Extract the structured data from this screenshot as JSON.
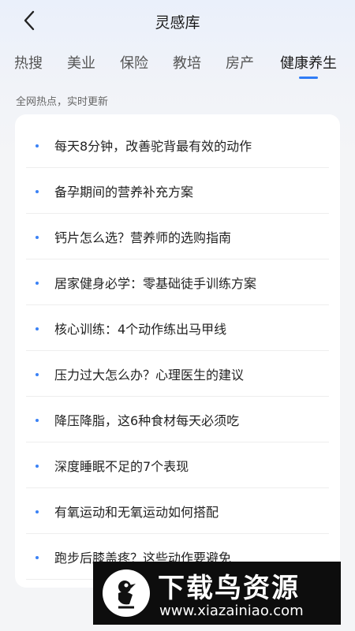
{
  "header": {
    "back_icon": "chevron-left-icon",
    "title": "灵感库"
  },
  "tabs": [
    {
      "label": "热搜",
      "active": false
    },
    {
      "label": "美业",
      "active": false
    },
    {
      "label": "保险",
      "active": false
    },
    {
      "label": "教培",
      "active": false
    },
    {
      "label": "房产",
      "active": false
    },
    {
      "label": "健康养生",
      "active": true
    }
  ],
  "accent_color": "#2f7cf6",
  "subtitle": "全网热点，实时更新",
  "list": {
    "bullet_icon": "dot-icon",
    "items": [
      "每天8分钟，改善驼背最有效的动作",
      "备孕期间的营养补充方案",
      "钙片怎么选？营养师的选购指南",
      "居家健身必学：零基础徒手训练方案",
      "核心训练：4个动作练出马甲线",
      "压力过大怎么办？心理医生的建议",
      "降压降脂，这6种食材每天必须吃",
      "深度睡眠不足的7个表现",
      "有氧运动和无氧运动如何搭配",
      "跑步后膝盖疼？这些动作要避免"
    ]
  },
  "watermark": {
    "title": "下载鸟资源",
    "url": "www.xiazainiao.com"
  }
}
